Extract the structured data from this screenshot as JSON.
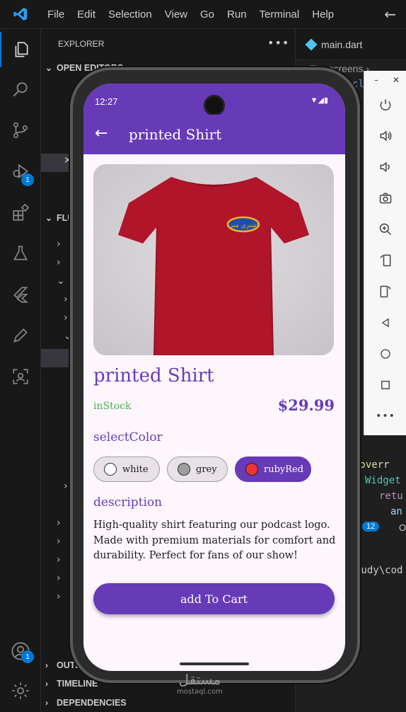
{
  "menu": [
    "File",
    "Edit",
    "Selection",
    "View",
    "Go",
    "Run",
    "Terminal",
    "Help"
  ],
  "activity_badges": {
    "run": "1",
    "accounts": "1"
  },
  "sidebar": {
    "title": "EXPLORER",
    "more": "•••",
    "open_editors": "OPEN EDITORS",
    "flutter_section": "FLU",
    "outline": "OUTLI",
    "timeline": "TIMELINE",
    "dependencies": "DEPENDENCIES"
  },
  "editor": {
    "tab_label": "main.dart",
    "breadcrumb": "lib › screens › ",
    "code_fragment_top": "cl",
    "code_override": "@overr",
    "code_widget": "Widget",
    "code_return": "retu",
    "code_an": "an",
    "panel_badge": "12",
    "panel_label": "OU",
    "terminal_path": "tudy\\cod",
    "brace": "}"
  },
  "emulator_window": {
    "min": "–",
    "close": "✕"
  },
  "phone": {
    "status_time": "12:27",
    "app_title": "printed Shirt",
    "product_name": "printed Shirt",
    "logo_text": "اشتري مني",
    "stock_status": "inStock",
    "price": "$29.99",
    "select_color_label": "selectColor",
    "colors": [
      {
        "name": "white",
        "swatch": "#ffffff",
        "selected": false
      },
      {
        "name": "grey",
        "swatch": "#9e9e9e",
        "selected": false
      },
      {
        "name": "rubyRed",
        "swatch": "#e53935",
        "selected": true
      }
    ],
    "description_label": "description",
    "description_text": "High-quality shirt featuring our podcast logo. Made with premium materials for comfort and durability. Perfect for fans of our show!",
    "add_to_cart": "add To Cart"
  },
  "watermark": {
    "arabic": "مستقل",
    "latin": "mostaql.com"
  },
  "colors": {
    "accent": "#673ab7",
    "instock": "#4caf50",
    "vscode_blue": "#0078d4",
    "shirt": "#b0152a"
  }
}
